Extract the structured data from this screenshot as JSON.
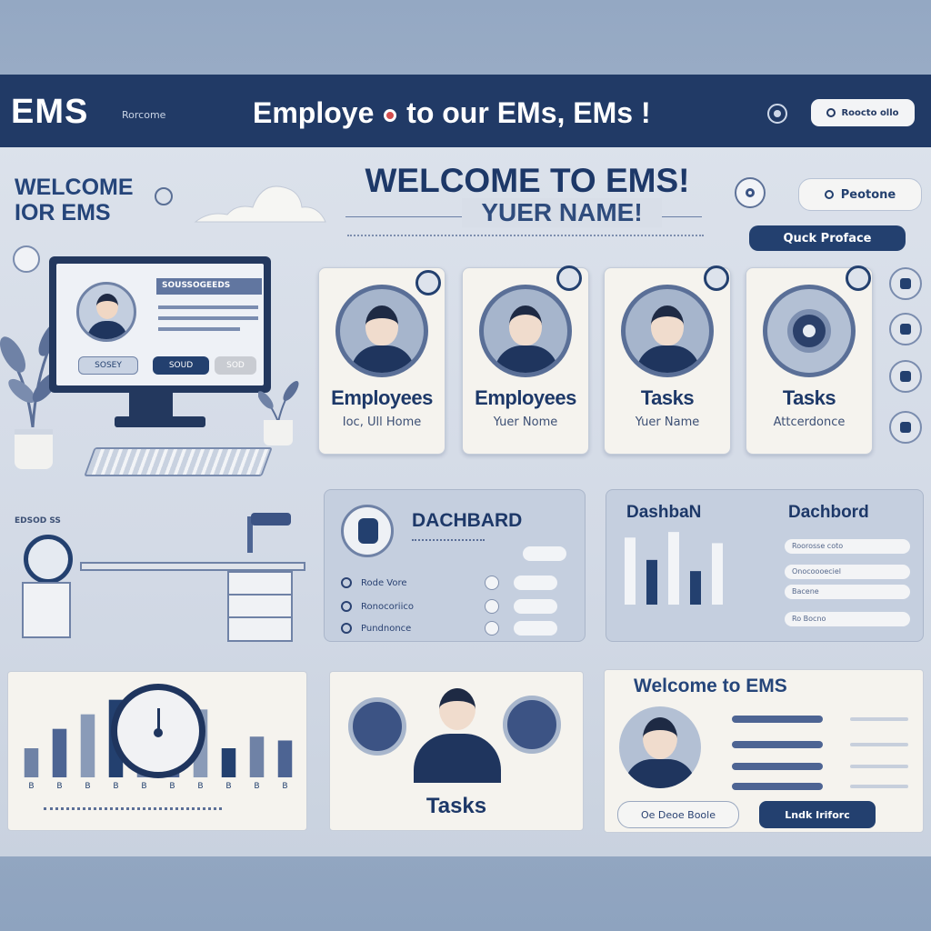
{
  "header": {
    "logo": "EMS",
    "logo_sub": "Rorcome",
    "banner_left": "Employe",
    "banner_right": "to our EMs, EMs !",
    "top_button": "Roocto ollo"
  },
  "welcome": {
    "left_line1": "WELCOME",
    "left_line2": "IOR EMS",
    "title": "WELCOME TO EMS!",
    "name": "YUER NAME!",
    "profile_button": "Peotone",
    "quick_button": "Quck Proface"
  },
  "monitor": {
    "screen_header": "SOUSSOGEEDS",
    "btn1": "SOSEY",
    "btn2": "SOUD",
    "btn3": "SOD"
  },
  "cards": [
    {
      "title": "Employees",
      "subtitle": "Ioc, Ull Home"
    },
    {
      "title": "Employees",
      "subtitle": "Yuer Nome"
    },
    {
      "title": "Tasks",
      "subtitle": "Yuer Name"
    },
    {
      "title": "Tasks",
      "subtitle": "Attcerdonce"
    }
  ],
  "desk_label": "EDSOD SS",
  "dashboard1": {
    "title": "DACHBARD",
    "rows": [
      "Rode     Vore",
      "Ronocoriico",
      "Pundnonce"
    ]
  },
  "dashboard2": {
    "title_left": "DashbaN",
    "title_right": "Dachbord",
    "rows": [
      "Roorosse coto",
      "Onocoooeciel",
      "Bacene",
      "Ro Bocno"
    ],
    "chart": [
      60,
      40,
      65,
      30,
      55
    ]
  },
  "bottom": {
    "bars": [
      30,
      50,
      65,
      80,
      35,
      48,
      70,
      30,
      42,
      38
    ],
    "axis_labels": [
      "B",
      "B",
      "B",
      "B",
      "B",
      "B",
      "B",
      "B",
      "B",
      "B"
    ],
    "tasks_title": "Tasks",
    "welcome_title": "Welcome to EMS",
    "btn_left": "Oe Deoe Boole",
    "btn_right": "Lndk Iriforc"
  }
}
